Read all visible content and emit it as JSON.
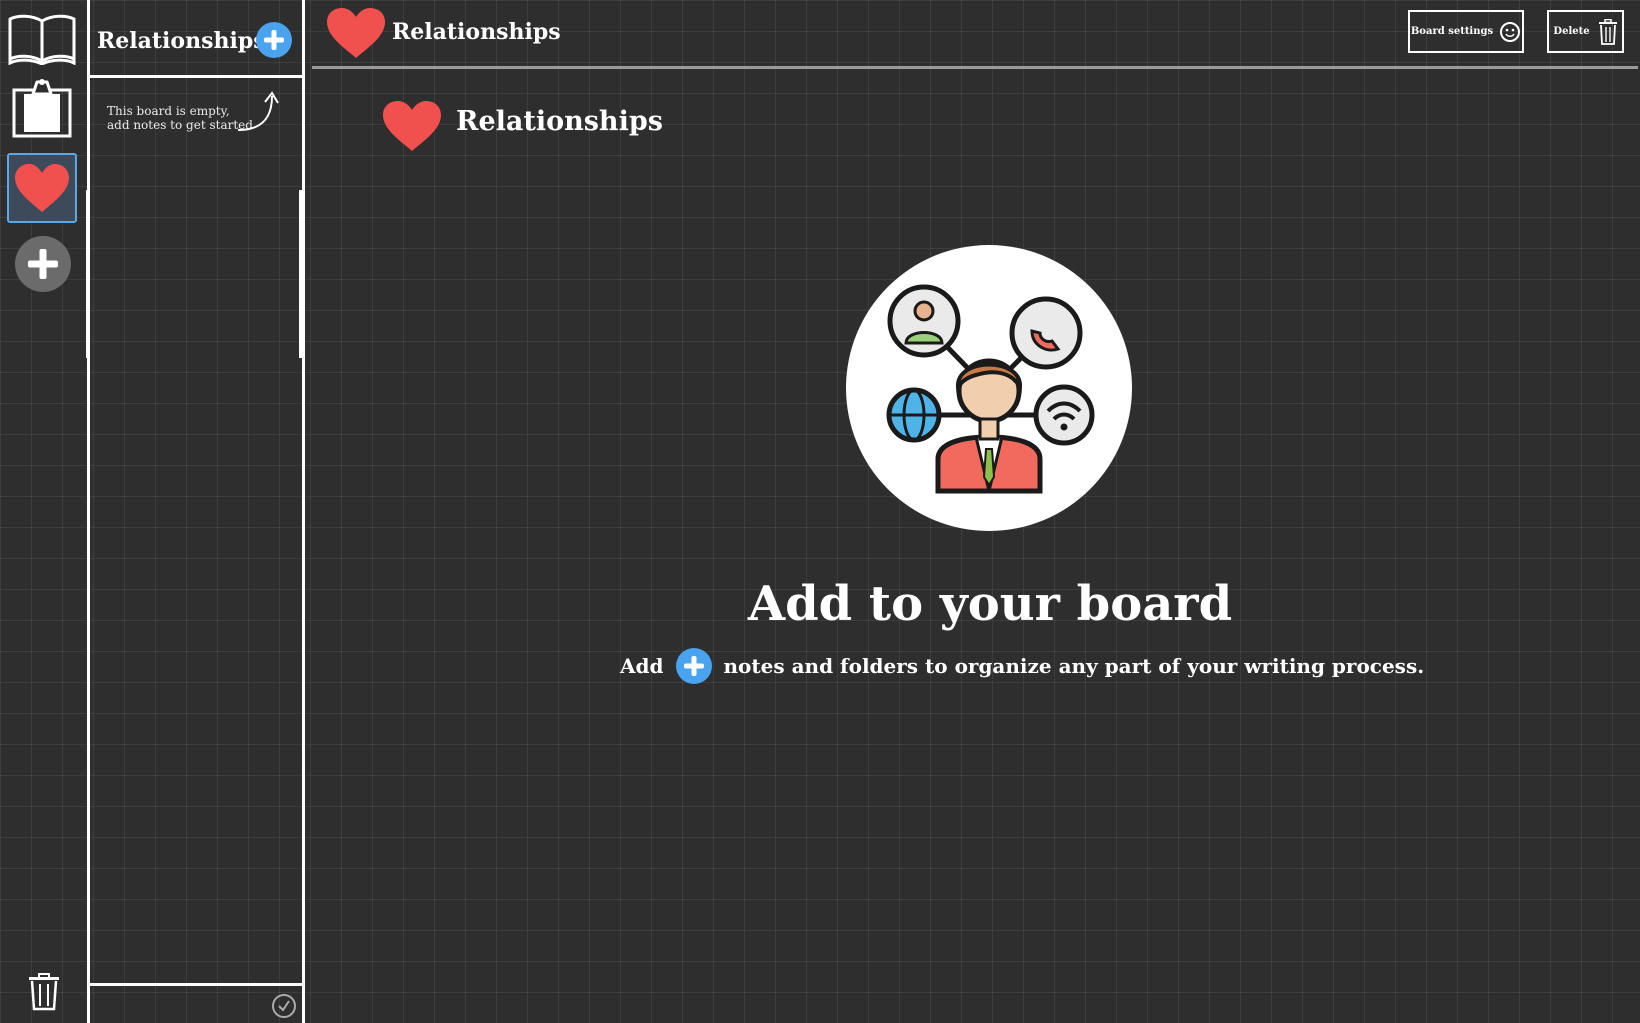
{
  "rail": {
    "items": [
      {
        "name": "book-icon"
      },
      {
        "name": "clipboard-icon"
      },
      {
        "name": "heart-icon",
        "selected": true
      },
      {
        "name": "plus-icon"
      }
    ],
    "trash_icon": "trash-icon",
    "accent": "#5aa8e8"
  },
  "panel": {
    "title": "Relationships",
    "empty_message": "This board is empty, add notes to get started"
  },
  "header": {
    "title": "Relationships",
    "settings_label": "Board settings",
    "delete_label": "Delete"
  },
  "board": {
    "title": "Relationships"
  },
  "empty_state": {
    "title": "Add to your board",
    "sub_prefix": "Add",
    "sub_suffix": "notes and folders to organize any part of your writing process."
  },
  "colors": {
    "heart": "#f0504e",
    "add_button": "#4aa3ee",
    "background": "#2e2e2e"
  }
}
